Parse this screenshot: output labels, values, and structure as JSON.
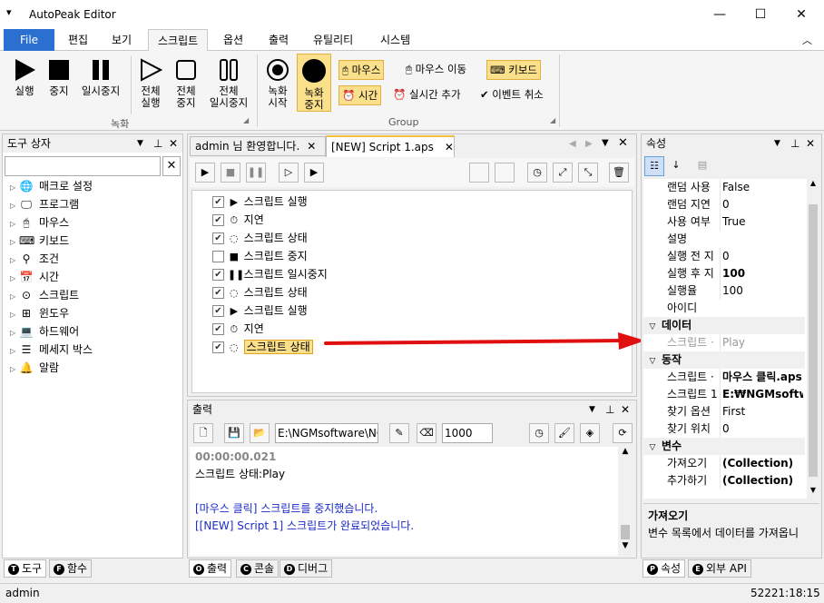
{
  "window": {
    "title": "AutoPeak Editor",
    "minimize": "—",
    "maximize": "☐",
    "close": "✕",
    "quick_access": "▾"
  },
  "menu": {
    "file": "File",
    "tabs": [
      "편집",
      "보기",
      "스크립트",
      "옵션",
      "출력",
      "유틸리티",
      "시스템"
    ],
    "collapse": "︿"
  },
  "ribbon": {
    "play": "실행",
    "stop": "중지",
    "pause": "일시중지",
    "all_play_1": "전체",
    "all_play_2": "실행",
    "all_stop_1": "전체",
    "all_stop_2": "중지",
    "all_pause_1": "전체",
    "all_pause_2": "일시중지",
    "group_record": "녹화",
    "rec_start_1": "녹화",
    "rec_start_2": "시작",
    "rec_stop_1": "녹화",
    "rec_stop_2": "중지",
    "mouse": "마우스",
    "mouse_move": "마우스 이동",
    "keyboard": "키보드",
    "time": "시간",
    "realtime_add": "실시간 추가",
    "event_cancel": "이벤트 취소",
    "group_group": "Group"
  },
  "toolbox": {
    "title": "도구 상자",
    "items": [
      "매크로 설정",
      "프로그램",
      "마우스",
      "키보드",
      "조건",
      "시간",
      "스크립트",
      "윈도우",
      "하드웨어",
      "메세지 박스",
      "알람"
    ],
    "tab_tools": "도구",
    "tab_functions": "함수"
  },
  "doc_tabs": {
    "welcome": "admin 님 환영합니다.",
    "script": "[NEW] Script 1.aps"
  },
  "script_rows": [
    {
      "checked": true,
      "icon": "▶",
      "label": "스크립트 실행"
    },
    {
      "checked": true,
      "icon": "⏱",
      "label": "지연"
    },
    {
      "checked": true,
      "icon": "◌",
      "label": "스크립트 상태"
    },
    {
      "checked": false,
      "icon": "■",
      "label": "스크립트 중지"
    },
    {
      "checked": true,
      "icon": "❚❚",
      "label": "스크립트 일시중지"
    },
    {
      "checked": true,
      "icon": "◌",
      "label": "스크립트 상태"
    },
    {
      "checked": true,
      "icon": "▶",
      "label": "스크립트 실행"
    },
    {
      "checked": true,
      "icon": "⏱",
      "label": "지연"
    },
    {
      "checked": true,
      "icon": "◌",
      "label": "스크립트 상태",
      "selected": true
    }
  ],
  "output": {
    "title": "출력",
    "path": "E:\\NGMsoftware\\NG",
    "count": "1000",
    "lines": [
      {
        "text": "00:00:00.021",
        "color": "#888888",
        "bold": true
      },
      {
        "text": "스크립트 상태:Play",
        "color": "#000000",
        "bold": false
      },
      {
        "text": "",
        "color": "#000000",
        "bold": false
      },
      {
        "text": "[마우스 클릭] 스크립트를 중지했습니다.",
        "color": "#1a2bc8",
        "bold": false
      },
      {
        "text": "[[NEW] Script 1] 스크립트가 완료되었습니다.",
        "color": "#1a2bc8",
        "bold": false
      }
    ],
    "tab_output": "출력",
    "tab_console": "콘솔",
    "tab_debug": "디버그"
  },
  "properties": {
    "title": "속성",
    "rows_top": [
      {
        "name": "랜덤 사용",
        "value": "False",
        "bold": false
      },
      {
        "name": "랜덤 지연",
        "value": "0",
        "bold": false
      },
      {
        "name": "사용 여부",
        "value": "True",
        "bold": false
      },
      {
        "name": "설명",
        "value": "",
        "bold": false
      },
      {
        "name": "실행 전 지",
        "value": "0",
        "bold": false
      },
      {
        "name": "실행 후 지",
        "value": "100",
        "bold": true
      },
      {
        "name": "실행율",
        "value": "100",
        "bold": false
      },
      {
        "name": "아이디",
        "value": "",
        "bold": false
      }
    ],
    "cat_data": "데이터",
    "data_row": {
      "name": "스크립트 ·",
      "value": "Play"
    },
    "cat_action": "동작",
    "rows_action": [
      {
        "name": "스크립트 ·",
        "value": "마우스 클릭.aps",
        "bold": true
      },
      {
        "name": "스크립트 1",
        "value": "E:₩NGMsoftware",
        "bold": true
      },
      {
        "name": "찾기 옵션",
        "value": "First",
        "bold": false
      },
      {
        "name": "찾기 위치",
        "value": "0",
        "bold": false
      }
    ],
    "cat_var": "변수",
    "rows_var": [
      {
        "name": "가져오기",
        "value": "(Collection)",
        "bold": true
      },
      {
        "name": "추가하기",
        "value": "(Collection)",
        "bold": true
      }
    ],
    "desc_title": "가져오기",
    "desc_text": "변수 목록에서 데이터를 가져옵니",
    "tab_props": "속성",
    "tab_api": "외부 API"
  },
  "status": {
    "user": "admin",
    "time": "52221:18:15"
  },
  "colors": {
    "accent": "#2b6fd1",
    "highlight": "#fbe08c",
    "arrow": "#e01010"
  }
}
